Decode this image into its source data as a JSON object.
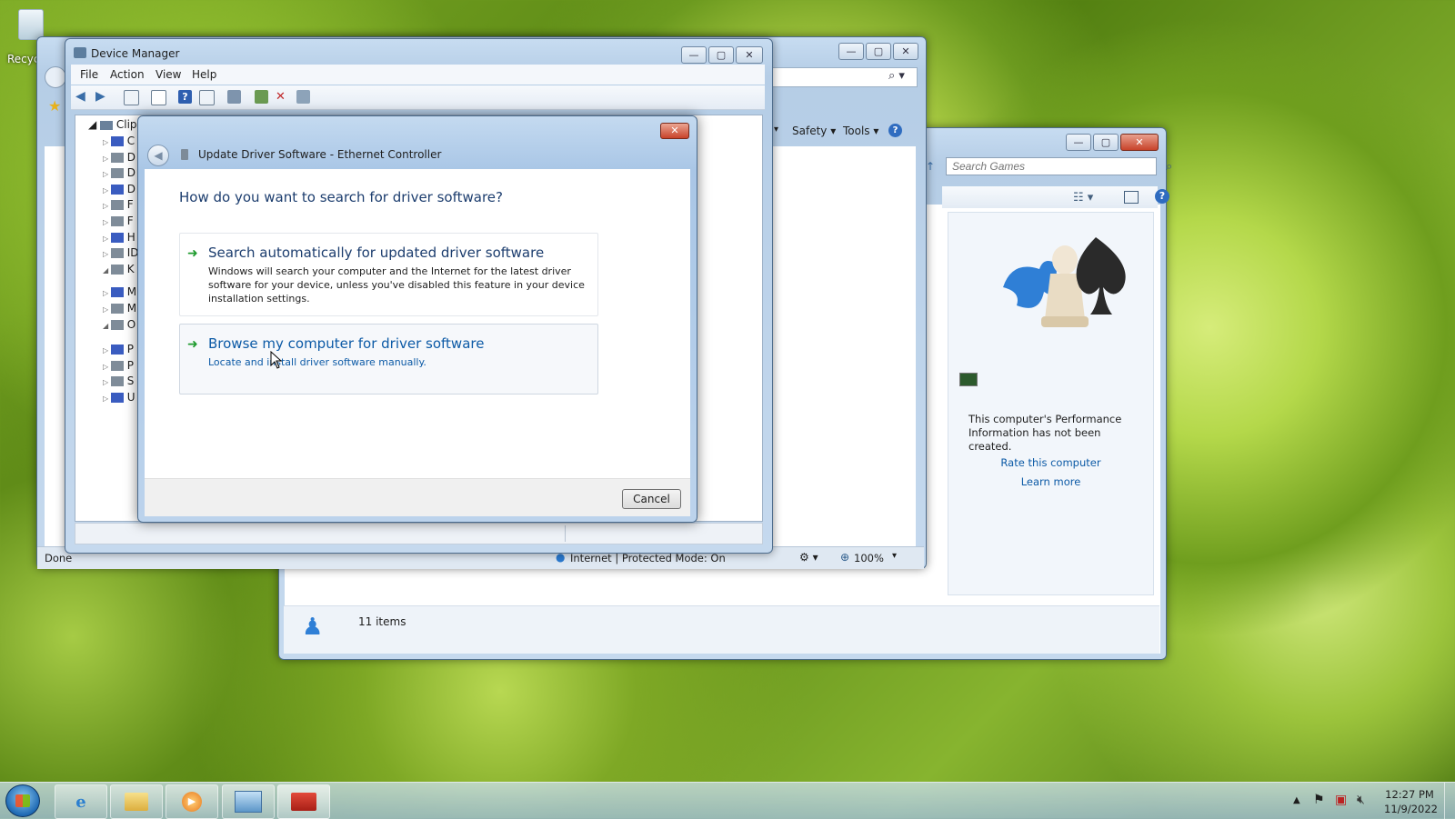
{
  "desktop": {
    "recycle_label": "Recyc"
  },
  "games_window": {
    "search_placeholder": "Search Games",
    "perf_text": "This computer's Performance Information has not been created.",
    "rate_link": "Rate this computer",
    "learn_link": "Learn more",
    "item_count": "11 items"
  },
  "ie_window": {
    "safety_label": "Safety",
    "tools_label": "Tools",
    "status_done": "Done",
    "status_zone": "Internet | Protected Mode: On",
    "zoom_label": "100%"
  },
  "device_manager": {
    "title": "Device Manager",
    "menu": [
      "File",
      "Action",
      "View",
      "Help"
    ],
    "tree_root": "Clipp",
    "tree_letters": [
      "C",
      "D",
      "D",
      "D",
      "F",
      "F",
      "H",
      "ID",
      "K",
      "M",
      "M",
      "O",
      "P",
      "P",
      "S",
      "U"
    ]
  },
  "dialog": {
    "title": "Update Driver Software - Ethernet Controller",
    "heading": "How do you want to search for driver software?",
    "option1_title": "Search automatically for updated driver software",
    "option1_desc": "Windows will search your computer and the Internet for the latest driver software for your device, unless you've disabled this feature in your device installation settings.",
    "option2_title": "Browse my computer for driver software",
    "option2_desc": "Locate and install driver software manually.",
    "cancel_label": "Cancel"
  },
  "taskbar": {
    "time": "12:27 PM",
    "date": "11/9/2022"
  },
  "colors": {
    "link_blue": "#0c5aa6",
    "heading_blue": "#1c3d6e",
    "close_red": "#c8432a",
    "arrow_green": "#1f9b2e"
  }
}
